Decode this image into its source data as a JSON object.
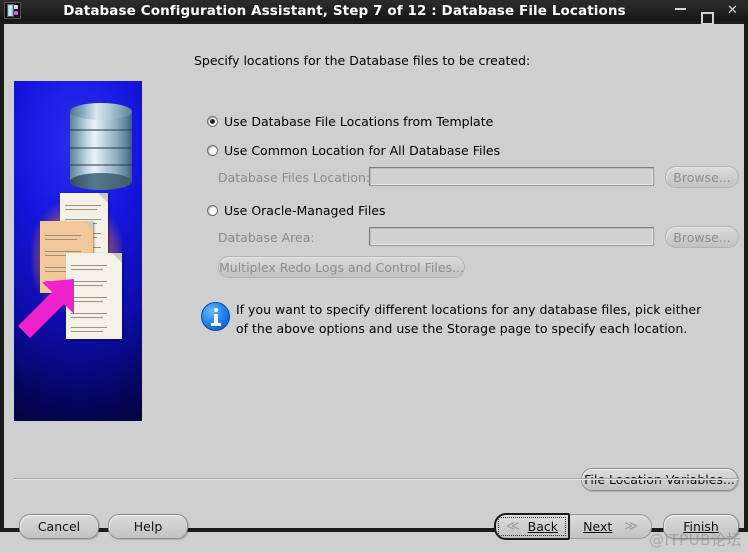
{
  "window": {
    "title": "Database Configuration Assistant, Step 7 of 12 : Database File Locations",
    "icon": "database-app-icon",
    "minimize_label": "",
    "maximize_label": "",
    "close_label": "✕"
  },
  "main": {
    "instruction": "Specify locations for the Database files to be created:",
    "options": [
      {
        "label": "Use Database File Locations from Template",
        "selected": true
      },
      {
        "label": "Use Common Location for All Database Files",
        "selected": false
      },
      {
        "label": "Use Oracle-Managed Files",
        "selected": false
      }
    ],
    "fields": [
      {
        "label": "Database Files Location:",
        "value": "",
        "placeholder": "",
        "enabled": false
      },
      {
        "label": "Database Area:",
        "value": "",
        "placeholder": "",
        "enabled": false
      }
    ],
    "browse_label": "Browse...",
    "multiplex_label": "Multiplex Redo Logs and Control Files...",
    "info": {
      "icon": "info-icon",
      "text": "If you want to specify different locations for any database files, pick either of the above options and use the Storage page to specify each location."
    },
    "file_location_variables_label": "File Location Variables..."
  },
  "illustration": {
    "name": "database-files-illustration",
    "background_color": "#1515dd",
    "arrow_color": "#ee22cc",
    "cylinder_color": "#c7dbe6",
    "highlight_color": "#f3a14a"
  },
  "footer": {
    "cancel_label": "Cancel",
    "help_label": "Help",
    "back_label": "Back",
    "back_mnemonic": "B",
    "next_label": "Next",
    "next_mnemonic": "N",
    "finish_label": "Finish",
    "finish_mnemonic": "F",
    "back_chevron": "≪",
    "next_chevron": "≫"
  },
  "watermark": {
    "text": "@ITPUB论坛"
  }
}
